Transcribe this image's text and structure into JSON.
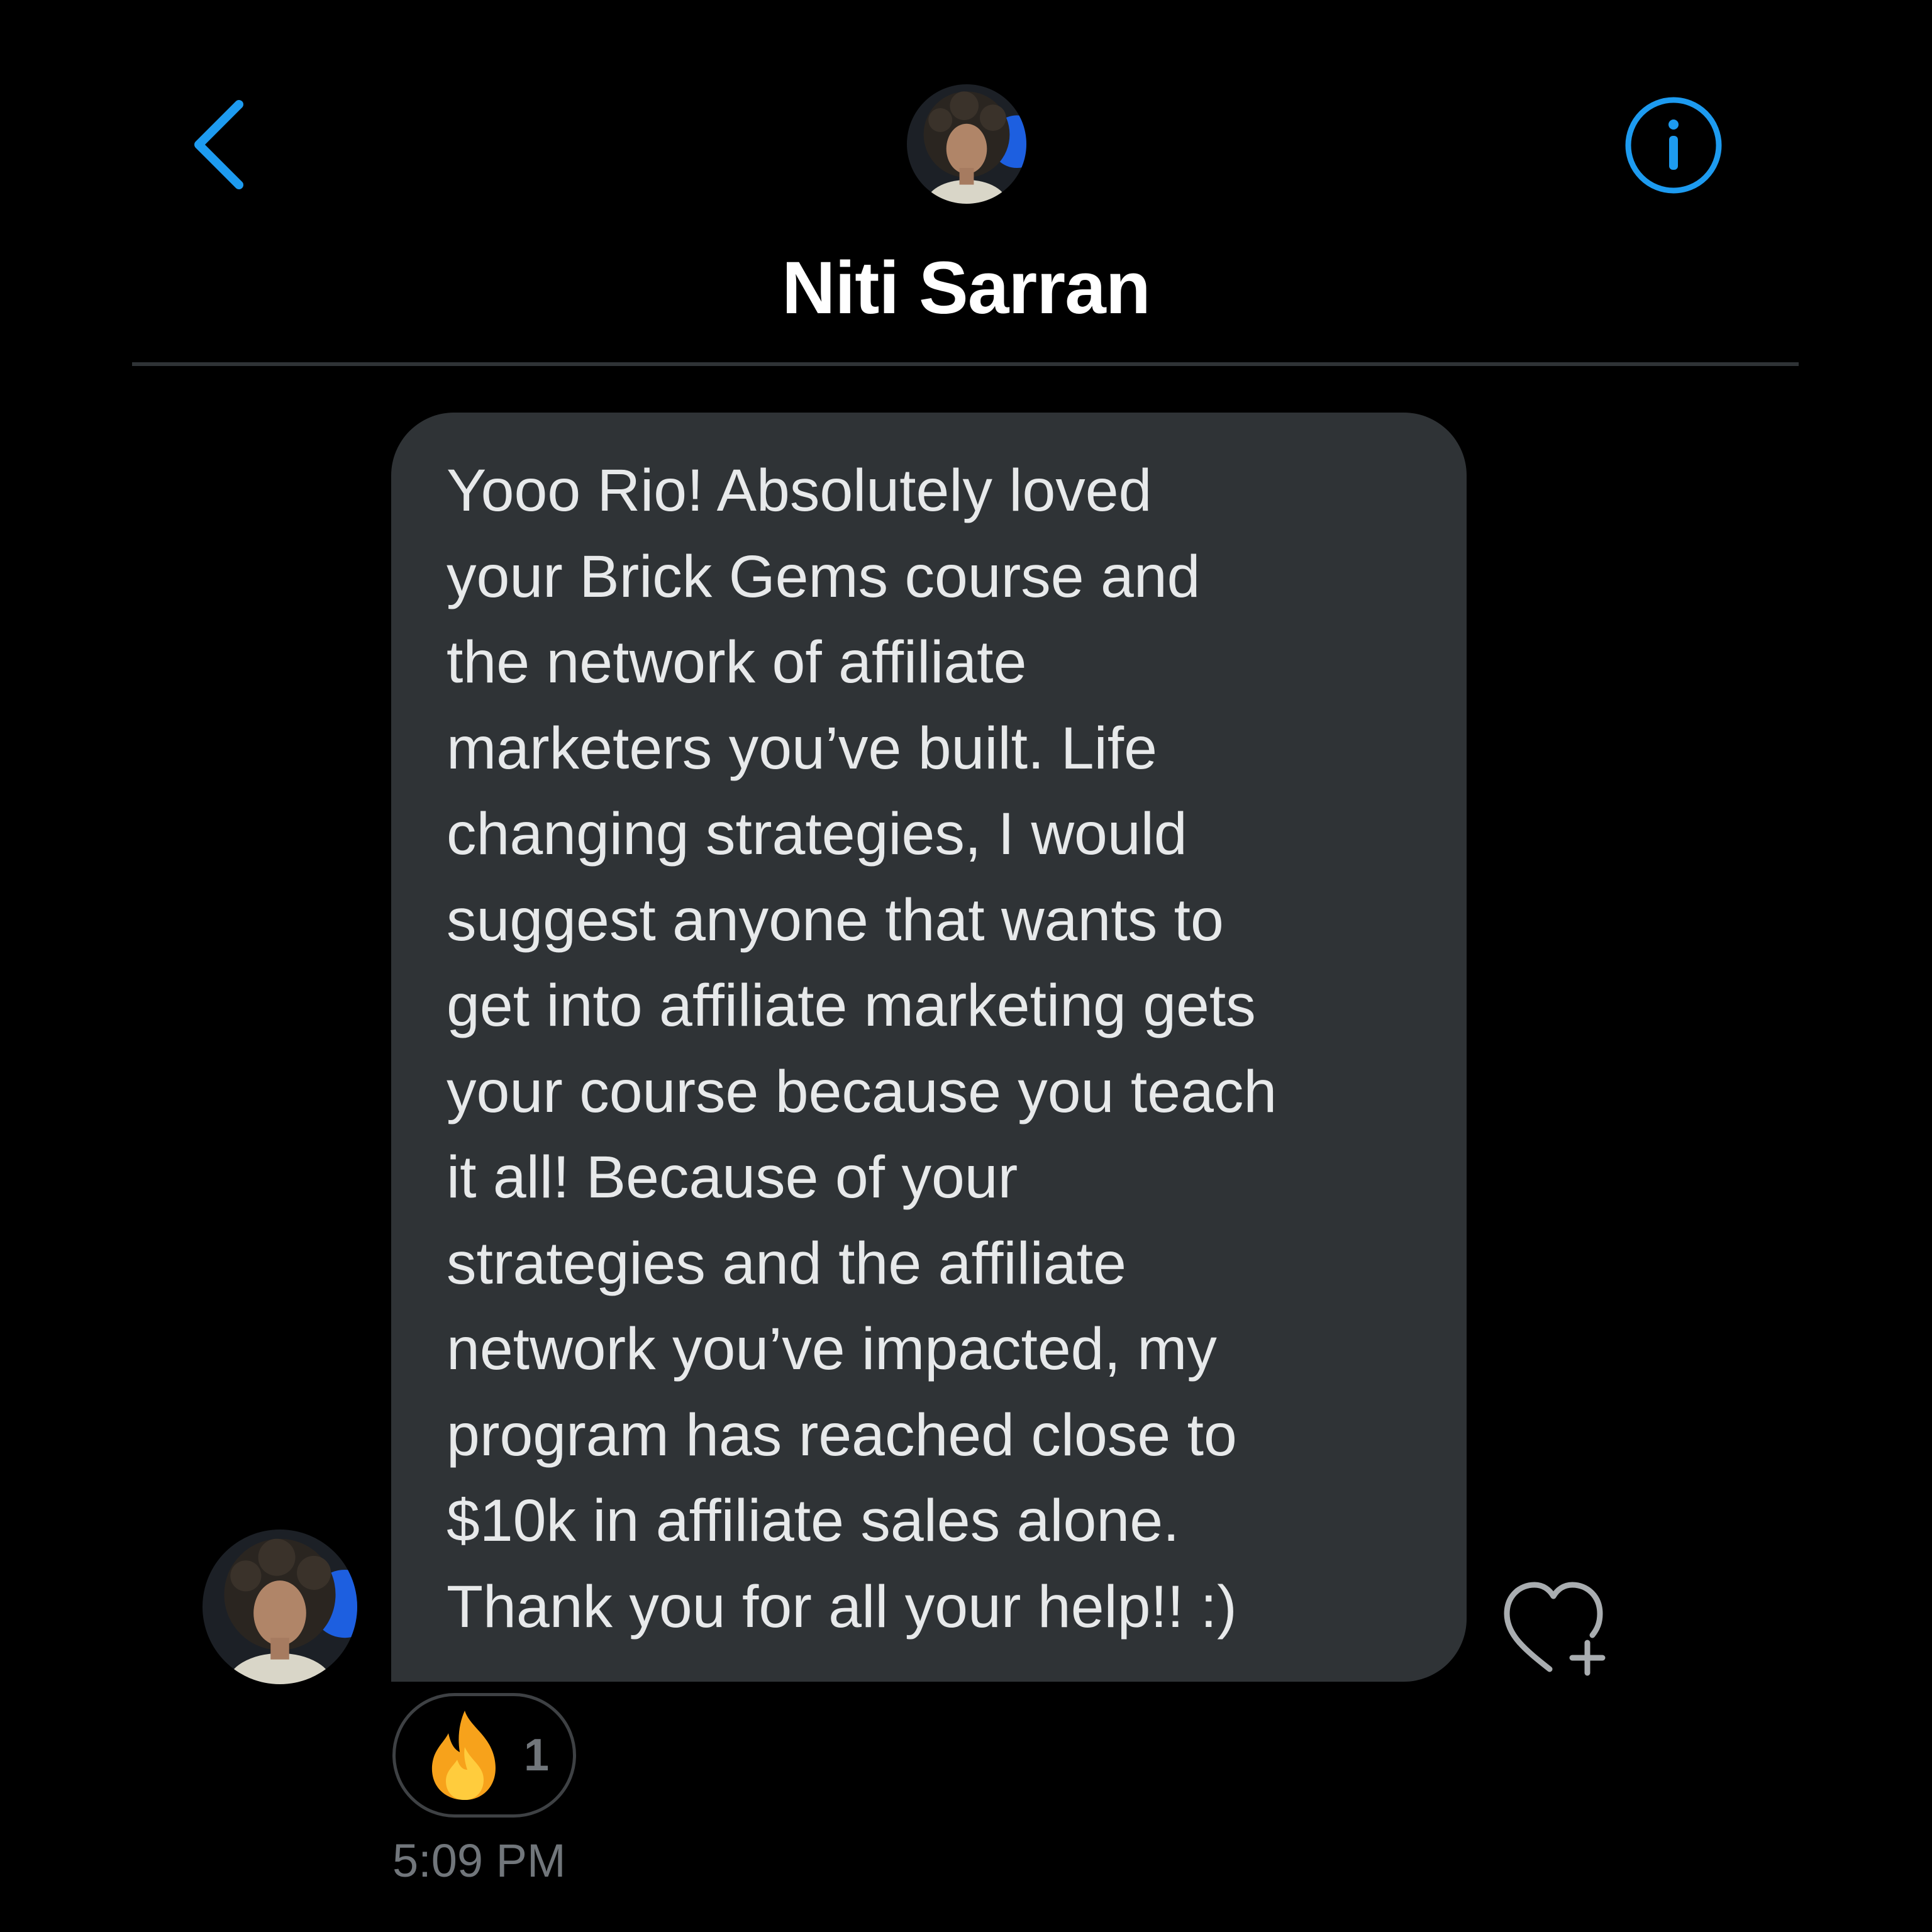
{
  "header": {
    "contact_name": "Niti Sarran",
    "back_icon": "chevron-left-icon",
    "info_icon": "info-circle-icon"
  },
  "message": {
    "text": "Yooo Rio! Absolutely loved\nyour Brick Gems course and\nthe network of affiliate\nmarketers you’ve built. Life\nchanging strategies, I would\nsuggest anyone that wants to\nget into affiliate marketing gets\nyour course because you teach\nit all! Because of your\nstrategies and the affiliate\nnetwork you’ve impacted, my\nprogram has reached close to\n$10k in affiliate sales alone.\nThank you for all your help!! :)",
    "reaction_emoji": "fire-emoji",
    "reaction_count": "1",
    "timestamp": "5:09 PM",
    "react_icon": "heart-plus-icon"
  },
  "colors": {
    "background": "#000000",
    "accent": "#1d9bf0",
    "bubble": "#2f3336",
    "text": "#e7e9ea",
    "muted": "#71767b",
    "divider": "#2f3336"
  }
}
